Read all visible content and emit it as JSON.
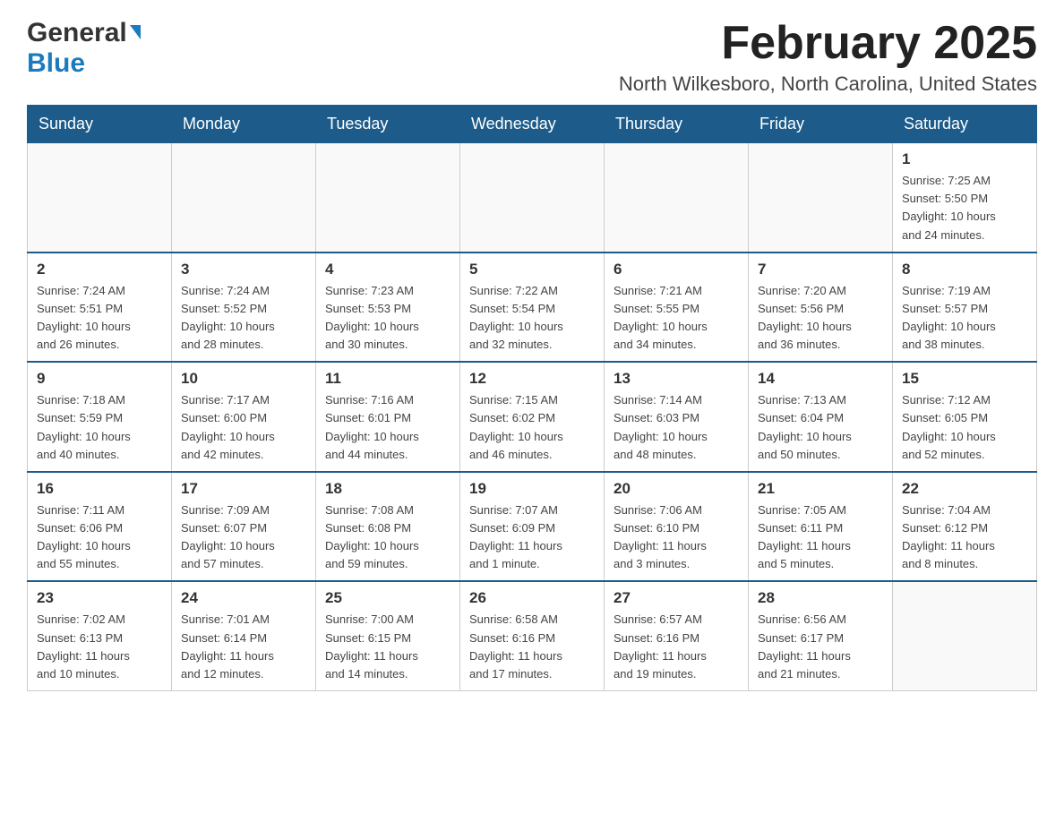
{
  "header": {
    "logo_general": "General",
    "logo_blue": "Blue",
    "month_title": "February 2025",
    "location": "North Wilkesboro, North Carolina, United States"
  },
  "days_of_week": [
    "Sunday",
    "Monday",
    "Tuesday",
    "Wednesday",
    "Thursday",
    "Friday",
    "Saturday"
  ],
  "weeks": [
    [
      {
        "day": "",
        "info": ""
      },
      {
        "day": "",
        "info": ""
      },
      {
        "day": "",
        "info": ""
      },
      {
        "day": "",
        "info": ""
      },
      {
        "day": "",
        "info": ""
      },
      {
        "day": "",
        "info": ""
      },
      {
        "day": "1",
        "info": "Sunrise: 7:25 AM\nSunset: 5:50 PM\nDaylight: 10 hours\nand 24 minutes."
      }
    ],
    [
      {
        "day": "2",
        "info": "Sunrise: 7:24 AM\nSunset: 5:51 PM\nDaylight: 10 hours\nand 26 minutes."
      },
      {
        "day": "3",
        "info": "Sunrise: 7:24 AM\nSunset: 5:52 PM\nDaylight: 10 hours\nand 28 minutes."
      },
      {
        "day": "4",
        "info": "Sunrise: 7:23 AM\nSunset: 5:53 PM\nDaylight: 10 hours\nand 30 minutes."
      },
      {
        "day": "5",
        "info": "Sunrise: 7:22 AM\nSunset: 5:54 PM\nDaylight: 10 hours\nand 32 minutes."
      },
      {
        "day": "6",
        "info": "Sunrise: 7:21 AM\nSunset: 5:55 PM\nDaylight: 10 hours\nand 34 minutes."
      },
      {
        "day": "7",
        "info": "Sunrise: 7:20 AM\nSunset: 5:56 PM\nDaylight: 10 hours\nand 36 minutes."
      },
      {
        "day": "8",
        "info": "Sunrise: 7:19 AM\nSunset: 5:57 PM\nDaylight: 10 hours\nand 38 minutes."
      }
    ],
    [
      {
        "day": "9",
        "info": "Sunrise: 7:18 AM\nSunset: 5:59 PM\nDaylight: 10 hours\nand 40 minutes."
      },
      {
        "day": "10",
        "info": "Sunrise: 7:17 AM\nSunset: 6:00 PM\nDaylight: 10 hours\nand 42 minutes."
      },
      {
        "day": "11",
        "info": "Sunrise: 7:16 AM\nSunset: 6:01 PM\nDaylight: 10 hours\nand 44 minutes."
      },
      {
        "day": "12",
        "info": "Sunrise: 7:15 AM\nSunset: 6:02 PM\nDaylight: 10 hours\nand 46 minutes."
      },
      {
        "day": "13",
        "info": "Sunrise: 7:14 AM\nSunset: 6:03 PM\nDaylight: 10 hours\nand 48 minutes."
      },
      {
        "day": "14",
        "info": "Sunrise: 7:13 AM\nSunset: 6:04 PM\nDaylight: 10 hours\nand 50 minutes."
      },
      {
        "day": "15",
        "info": "Sunrise: 7:12 AM\nSunset: 6:05 PM\nDaylight: 10 hours\nand 52 minutes."
      }
    ],
    [
      {
        "day": "16",
        "info": "Sunrise: 7:11 AM\nSunset: 6:06 PM\nDaylight: 10 hours\nand 55 minutes."
      },
      {
        "day": "17",
        "info": "Sunrise: 7:09 AM\nSunset: 6:07 PM\nDaylight: 10 hours\nand 57 minutes."
      },
      {
        "day": "18",
        "info": "Sunrise: 7:08 AM\nSunset: 6:08 PM\nDaylight: 10 hours\nand 59 minutes."
      },
      {
        "day": "19",
        "info": "Sunrise: 7:07 AM\nSunset: 6:09 PM\nDaylight: 11 hours\nand 1 minute."
      },
      {
        "day": "20",
        "info": "Sunrise: 7:06 AM\nSunset: 6:10 PM\nDaylight: 11 hours\nand 3 minutes."
      },
      {
        "day": "21",
        "info": "Sunrise: 7:05 AM\nSunset: 6:11 PM\nDaylight: 11 hours\nand 5 minutes."
      },
      {
        "day": "22",
        "info": "Sunrise: 7:04 AM\nSunset: 6:12 PM\nDaylight: 11 hours\nand 8 minutes."
      }
    ],
    [
      {
        "day": "23",
        "info": "Sunrise: 7:02 AM\nSunset: 6:13 PM\nDaylight: 11 hours\nand 10 minutes."
      },
      {
        "day": "24",
        "info": "Sunrise: 7:01 AM\nSunset: 6:14 PM\nDaylight: 11 hours\nand 12 minutes."
      },
      {
        "day": "25",
        "info": "Sunrise: 7:00 AM\nSunset: 6:15 PM\nDaylight: 11 hours\nand 14 minutes."
      },
      {
        "day": "26",
        "info": "Sunrise: 6:58 AM\nSunset: 6:16 PM\nDaylight: 11 hours\nand 17 minutes."
      },
      {
        "day": "27",
        "info": "Sunrise: 6:57 AM\nSunset: 6:16 PM\nDaylight: 11 hours\nand 19 minutes."
      },
      {
        "day": "28",
        "info": "Sunrise: 6:56 AM\nSunset: 6:17 PM\nDaylight: 11 hours\nand 21 minutes."
      },
      {
        "day": "",
        "info": ""
      }
    ]
  ]
}
